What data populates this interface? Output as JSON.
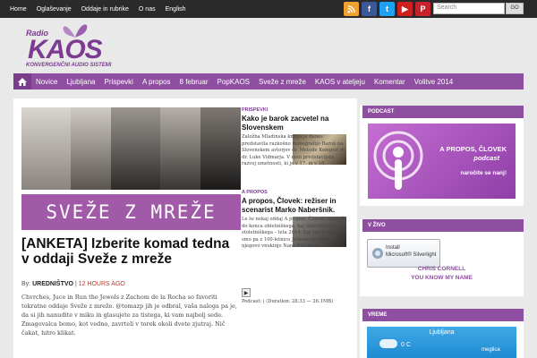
{
  "topnav": {
    "items": [
      "Home",
      "Oglaševanje",
      "Oddaje in rubrike",
      "O nas",
      "English"
    ]
  },
  "social": {
    "icons": [
      "rss-icon",
      "facebook-icon",
      "twitter-icon",
      "youtube-icon",
      "pinterest-icon"
    ],
    "colors": [
      "#f0a030",
      "#3b5998",
      "#1da1f2",
      "#cd201f",
      "#c8232c"
    ]
  },
  "search": {
    "placeholder": "Search",
    "button": "GO"
  },
  "logo": {
    "radio": "Radio",
    "kaos": "KAOS",
    "tagline": "KONVERGENČNI AUDIO SISTEMI"
  },
  "mainnav": {
    "items": [
      "Novice",
      "Ljubljana",
      "Prispevki",
      "A propos",
      "8 februar",
      "PopKAOS",
      "Sveže z mreže",
      "KAOS v ateljeju",
      "Komentar",
      "Volitve 2014"
    ]
  },
  "feature": {
    "banner": "SVEŽE Z MREŽE",
    "headline": "[ANKETA] Izberite komad tedna v oddaji Sveže z mreže",
    "by_label": "By:",
    "author": "UREDNIŠTVO",
    "time": "12 HOURS AGO",
    "excerpt": "Chvrches, Juce in Run the Jewels z Zachom de la Rocha so favoriti tokratne oddaje Sveže z mreže. @tomazp jih je odbral, vaša naloga pa je, da si jih nanudite v miku in glasujete za tistega, ki vam najbolj sede. Zmagovalca bomo, kot vedno, zavrteli v torek okoli dvete zjutraj. Nič čakat, hitro klikat."
  },
  "side_posts": [
    {
      "category": "PRISPEVKI",
      "title": "Kako je barok zacvetel na Slovenskem",
      "text": "Založba Mladinska knjiga je danes predstavila razkošno monografijo Barok na Slovenskem avtorjev dr. Metode Kemperl in dr. Luke Vidmarja. V njen predstavljata razvoj umetnosti, ki je v 17. in v 18."
    },
    {
      "category": "A PROPOS",
      "title": "A propos, Človek: režiser in scenarist Marko Naberšnik.",
      "text": "Le še nekaj oddaj A propos, Človek! nas loči do konca obletniškega, kaj obletniškega – stoletniškega – leta 2014. Saj veste začeli smo pa z 100-letnico Jetkovega rojstva in njegovo vnukinjo Nano Milčinski."
    },
    {
      "podcast_line": "Podcast: | (Duration: 28:33 — 26.1MB)"
    }
  ],
  "podcast_widget": {
    "title": "PODCAST",
    "line1": "A PROPOS, ČLOVEK",
    "line2": "podcast",
    "line3": "naročite se nanj!"
  },
  "live_widget": {
    "title": "V ŽIVO",
    "install_line1": "Install",
    "install_line2": "Microsoft® Silverlight",
    "artist": "CHRIS CORNELL",
    "track": "YOU KNOW MY NAME"
  },
  "weather_widget": {
    "title": "VREME",
    "city": "Ljubljana",
    "temp": "0 C",
    "condition": "meglica"
  }
}
